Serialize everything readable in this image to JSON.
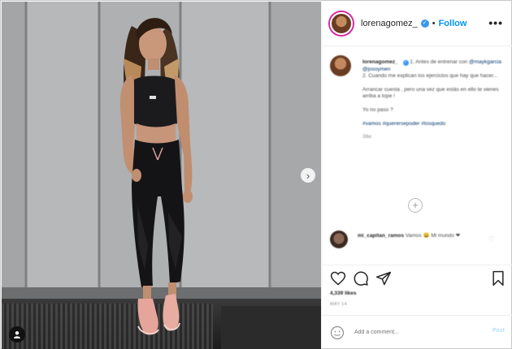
{
  "header": {
    "username": "lorenagomez_",
    "verified_badge": "✓",
    "separator": "•",
    "follow_label": "Follow",
    "more_label": "•••"
  },
  "post": {
    "photo_icon": "woman-portrait-photo",
    "next_icon": "chevron-right-icon",
    "tag_icon": "user-tag-icon"
  },
  "caption": {
    "username": "lorenagomez_",
    "line1": "1. Antes de entrenar con",
    "mentions": "@maykgarcia @josoymen",
    "line1b": "2. Cuando me explican los ejercicios que hay que hacer...",
    "line2": "Arrancar cuesta , pero una vez que estás en ello te vienes arriba a tope !",
    "line3": "Yo no paso ?",
    "hashtags": "#vamos #querersepoder #losquedo",
    "meta": "38w"
  },
  "comment": {
    "username": "mi_capitan_ramos",
    "text": "Vamos 😀 Mi mundo ❤",
    "heart_icon": "heart-outline-icon"
  },
  "actions": {
    "like_icon": "heart-icon",
    "comment_icon": "comment-icon",
    "share_icon": "share-icon",
    "save_icon": "bookmark-icon",
    "likes": "4,339 likes",
    "date": "MAY 14"
  },
  "composer": {
    "emoji_icon": "smiley-icon",
    "placeholder": "Add a comment...",
    "post_label": "Post",
    "load_more": "+"
  },
  "colors": {
    "accent": "#0095f6",
    "verified": "#3897f0",
    "border": "#efefef"
  }
}
